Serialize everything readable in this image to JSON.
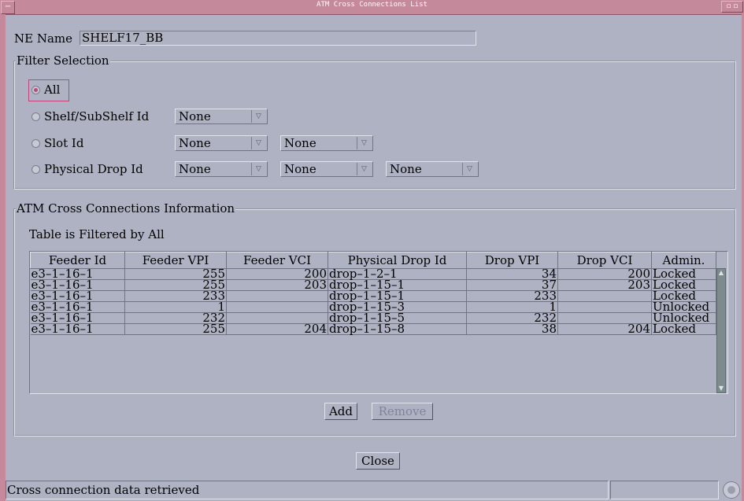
{
  "window": {
    "title": "ATM Cross Connections List",
    "menu_glyph": "−",
    "controls_glyph": "▫ ▫"
  },
  "ne": {
    "label": "NE Name",
    "value": "SHELF17_BB"
  },
  "filter": {
    "legend": "Filter Selection",
    "options": [
      {
        "label": "All",
        "selected": true
      },
      {
        "label": "Shelf/SubShelf Id",
        "selected": false
      },
      {
        "label": "Slot Id",
        "selected": false
      },
      {
        "label": "Physical Drop Id",
        "selected": false
      }
    ],
    "dropdown_value": "None",
    "dropdown_arrow": "▽"
  },
  "info": {
    "legend": "ATM Cross Connections Information",
    "filter_note": "Table is Filtered by All",
    "columns": [
      "Feeder Id",
      "Feeder VPI",
      "Feeder VCI",
      "Physical Drop Id",
      "Drop VPI",
      "Drop VCI",
      "Admin."
    ],
    "rows": [
      [
        "e3–1–16–1",
        "255",
        "200",
        "drop–1–2–1",
        "34",
        "200",
        "Locked"
      ],
      [
        "e3–1–16–1",
        "255",
        "203",
        "drop–1–15–1",
        "37",
        "203",
        "Locked"
      ],
      [
        "e3–1–16–1",
        "233",
        "",
        "drop–1–15–1",
        "233",
        "",
        "Locked"
      ],
      [
        "e3–1–16–1",
        "1",
        "",
        "drop–1–15–3",
        "1",
        "",
        "Unlocked"
      ],
      [
        "e3–1–16–1",
        "232",
        "",
        "drop–1–15–5",
        "232",
        "",
        "Unlocked"
      ],
      [
        "e3–1–16–1",
        "255",
        "204",
        "drop–1–15–8",
        "38",
        "204",
        "Locked"
      ]
    ],
    "add_label": "Add",
    "remove_label": "Remove"
  },
  "close_label": "Close",
  "status": {
    "message": "Cross connection data retrieved"
  },
  "colors": {
    "titlebar": "#c48a9c",
    "background": "#aeb2c3",
    "selection": "#c0457a"
  }
}
